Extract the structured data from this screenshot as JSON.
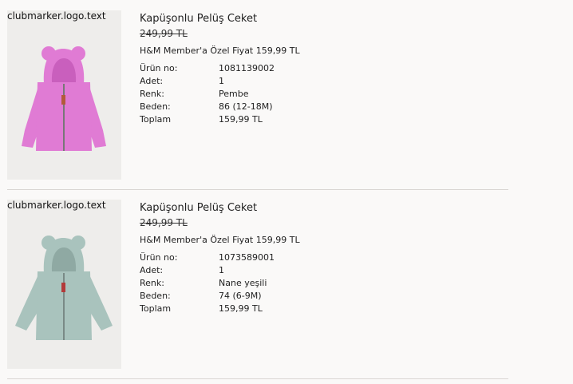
{
  "items": [
    {
      "logo_text": "clubmarker.logo.text",
      "title": "Kapüşonlu Pelüş Ceket",
      "old_price": "249,99 TL",
      "member_price": "H&M Member'a Özel Fiyat 159,99 TL",
      "jacket_color": "#e07bd4",
      "jacket_shade": "#c95fbd",
      "details": [
        {
          "label": "Ürün no:",
          "value": "1081139002"
        },
        {
          "label": "Adet:",
          "value": "1"
        },
        {
          "label": "Renk:",
          "value": "Pembe"
        },
        {
          "label": "Beden:",
          "value": "86 (12-18M)"
        },
        {
          "label": "Toplam",
          "value": "159,99 TL"
        }
      ]
    },
    {
      "logo_text": "clubmarker.logo.text",
      "title": "Kapüşonlu Pelüş Ceket",
      "old_price": "249,99 TL",
      "member_price": "H&M Member'a Özel Fiyat 159,99 TL",
      "jacket_color": "#a9c3bd",
      "jacket_shade": "#8fa9a3",
      "details": [
        {
          "label": "Ürün no:",
          "value": "1073589001"
        },
        {
          "label": "Adet:",
          "value": "1"
        },
        {
          "label": "Renk:",
          "value": "Nane yeşili"
        },
        {
          "label": "Beden:",
          "value": "74 (6-9M)"
        },
        {
          "label": "Toplam",
          "value": "159,99 TL"
        }
      ]
    }
  ]
}
